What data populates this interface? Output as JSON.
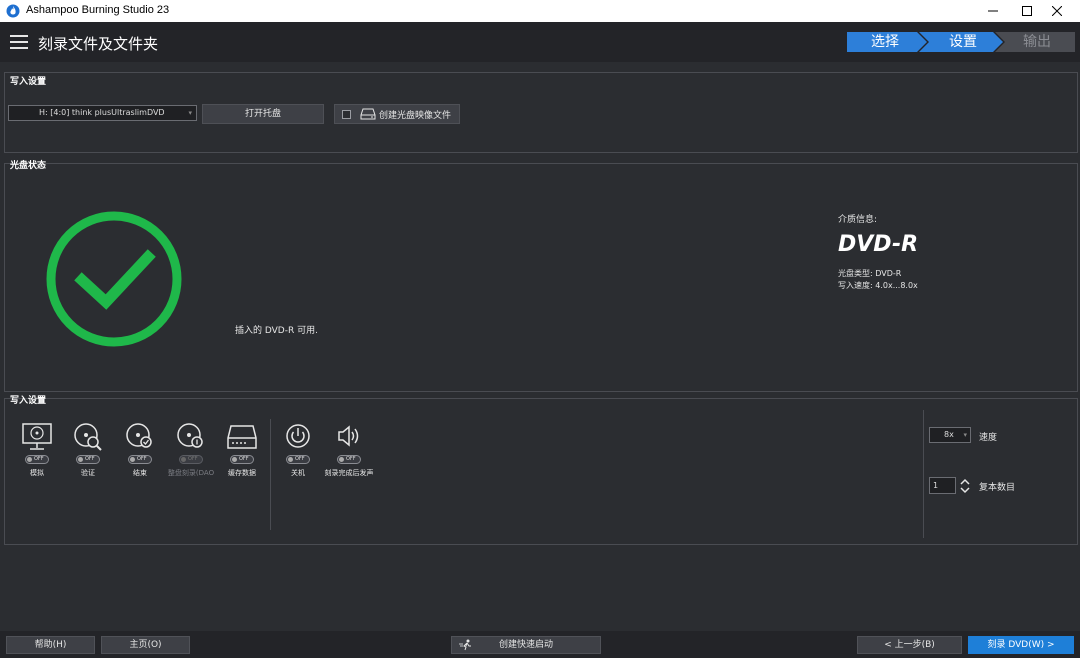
{
  "window": {
    "title": "Ashampoo Burning Studio 23",
    "minimize": "—",
    "maximize": "☐",
    "close": "✕"
  },
  "header": {
    "title": "刻录文件及文件夹",
    "steps": [
      {
        "label": "选择",
        "state": "active"
      },
      {
        "label": "设置",
        "state": "active"
      },
      {
        "label": "输出",
        "state": "inactive"
      }
    ]
  },
  "write_settings": {
    "title": "写入设置",
    "drive": "H: [4:0] think   plusUltraslimDVD",
    "open_tray_label": "打开托盘",
    "create_image_label": "创建光盘映像文件",
    "create_image_checked": false
  },
  "disc_status": {
    "title": "光盘状态",
    "message": "插入的 DVD-R 可用.",
    "media_label": "介质信息:",
    "media_type": "DVD-R",
    "disc_type_line": "光盘类型: DVD-R",
    "write_speed_line": "写入速度: 4.0x...8.0x"
  },
  "write_options": {
    "title": "写入设置",
    "options": [
      {
        "label": "模拟",
        "state": "OFF",
        "icon": "monitor-disc-icon",
        "enabled": true
      },
      {
        "label": "验证",
        "state": "OFF",
        "icon": "disc-search-icon",
        "enabled": true
      },
      {
        "label": "结束",
        "state": "OFF",
        "icon": "disc-check-icon",
        "enabled": true
      },
      {
        "label": "整盘刻录(DAO",
        "state": "OFF",
        "icon": "disc-one-icon",
        "enabled": false
      },
      {
        "label": "缓存数据",
        "state": "OFF",
        "icon": "drive-icon",
        "enabled": true
      },
      {
        "label": "关机",
        "state": "OFF",
        "icon": "power-icon",
        "enabled": true
      },
      {
        "label": "刻录完成后发声",
        "state": "OFF",
        "icon": "speaker-icon",
        "enabled": true
      }
    ],
    "speed_value": "8x",
    "speed_label": "速度",
    "copies_value": "1",
    "copies_label": "复本数目"
  },
  "footer": {
    "help": "帮助(H)",
    "home": "主页(O)",
    "quick_start": "创建快速启动",
    "back": "< 上一步(B)",
    "burn": "刻录 DVD(W) >"
  },
  "colors": {
    "accent": "#1e7fd8",
    "success": "#1fb84a",
    "background": "#2b2d31"
  }
}
